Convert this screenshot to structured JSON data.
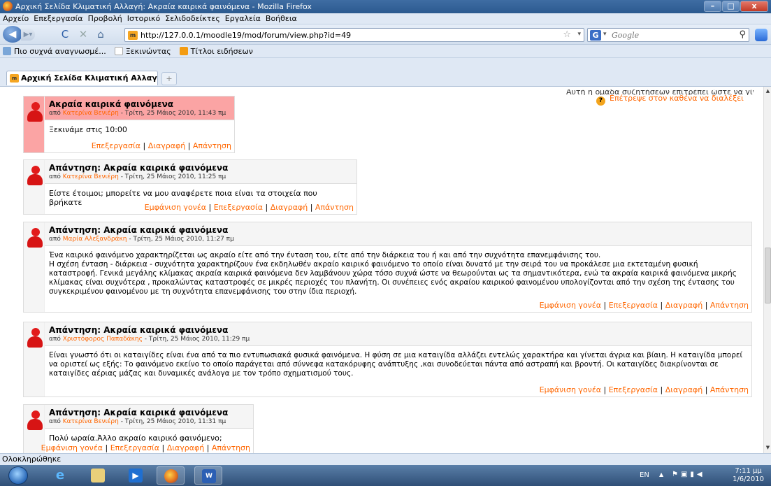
{
  "window": {
    "title": "Αρχική Σελίδα Κλιματική Αλλαγή: Ακραία καιρικά φαινόμενα - Mozilla Firefox",
    "min": "–",
    "max": "□",
    "close": "x"
  },
  "menu": [
    "Αρχείο",
    "Επεξεργασία",
    "Προβολή",
    "Ιστορικό",
    "Σελιδοδείκτες",
    "Εργαλεία",
    "Βοήθεια"
  ],
  "nav": {
    "url": "http://127.0.0.1/moodle19/mod/forum/view.php?id=49",
    "search_placeholder": "Google"
  },
  "bookmarks": [
    "Πιο συχνά αναγνωσμέ...",
    "Ξεκινώντας",
    "Τίτλοι ειδήσεων"
  ],
  "tab": {
    "label": "Αρχική Σελίδα Κλιματική Αλλαγή: Α...",
    "close": "×",
    "new": "+"
  },
  "forum": {
    "top_text_clipped": "Αυτή η ομάδα συζητήσεων επιτρέπει ώστε να γίνουν συνδρομητές",
    "subscribe_option": "Επέτρεψε στον καθένα να διαλέξει",
    "posts": [
      {
        "subject": "Ακραία καιρικά φαινόμενα",
        "by": "από",
        "author": "Κατερίνα Βενιέρη",
        "date": " - Τρίτη, 25 Μάιος 2010, 11:43 πμ",
        "body": "Ξεκινάμε στις 10:00",
        "cmds": [
          "Επεξεργασία",
          "Διαγραφή",
          "Απάντηση"
        ]
      },
      {
        "subject": "Απάντηση: Ακραία καιρικά φαινόμενα",
        "by": "από",
        "author": "Κατερίνα Βενιέρη",
        "date": " - Τρίτη, 25 Μάιος 2010, 11:25 πμ",
        "body": "Είστε έτοιμοι; μπορείτε να μου αναφέρετε ποια είναι τα στοιχεία που βρήκατε",
        "cmds": [
          "Εμφάνιση γονέα",
          "Επεξεργασία",
          "Διαγραφή",
          "Απάντηση"
        ]
      },
      {
        "subject": "Απάντηση: Ακραία καιρικά φαινόμενα",
        "by": "από",
        "author": "Μαρία Αλεξανδράκη",
        "date": " - Τρίτη, 25 Μάιος 2010, 11:27 πμ",
        "body": "Ένα καιρικό φαινόμενο χαρακτηρίζεται ως ακραίο είτε από την ένταση του, είτε από την διάρκεια του ή και από την συχνότητα επανεμφάνισης του.\nΗ σχέση ένταση - διάρκεια - συχνότητα χαρακτηρίζουν ένα εκδηλωθέν ακραίο καιρικό φαινόμενο το οποίο είναι δυνατό με την σειρά του να προκάλεσε μια εκτεταμένη φυσική καταστροφή. Γενικά μεγάλης κλίμακας ακραία καιρικά φαινόμενα δεν λαμβάνουν χώρα τόσο συχνά ώστε να θεωρούνται ως τα σημαντικότερα, ενώ τα ακραία καιρικά φαινόμενα μικρής κλίμακας είναι συχνότερα , προκαλώντας καταστροφές σε μικρές περιοχές του πλανήτη. Οι συνέπειες ενός ακραίου καιρικού φαινομένου υπολογίζονται από την σχέση της έντασης του συγκεκριμένου φαινομένου με τη συχνότητα επανεμφάνισης του στην ίδια περιοχή.",
        "cmds": [
          "Εμφάνιση γονέα",
          "Επεξεργασία",
          "Διαγραφή",
          "Απάντηση"
        ]
      },
      {
        "subject": "Απάντηση: Ακραία καιρικά φαινόμενα",
        "by": "από",
        "author": "Χριστόφορος Παπαδάκης",
        "date": " - Τρίτη, 25 Μάιος 2010, 11:29 πμ",
        "body": "Είναι γνωστό ότι οι καταιγίδες είναι ένα από τα πιο εντυπωσιακά φυσικά φαινόμενα. Η φύση σε μια καταιγίδα αλλάζει εντελώς χαρακτήρα και γίνεται άγρια και βίαιη. Η καταιγίδα μπορεί να οριστεί ως εξής: Το φαινόμενο εκείνο το οποίο παράγεται από σύννεφα κατακόρυφης ανάπτυξης ,και συνοδεύεται πάντα από αστραπή και βροντή. Οι καταιγίδες διακρίνονται σε καταιγίδες αέριας μάζας και δυναμικές ανάλογα με τον τρόπο σχηματισμού τους.",
        "cmds": [
          "Εμφάνιση γονέα",
          "Επεξεργασία",
          "Διαγραφή",
          "Απάντηση"
        ]
      },
      {
        "subject": "Απάντηση: Ακραία καιρικά φαινόμενα",
        "by": "από",
        "author": "Κατερίνα Βενιέρη",
        "date": " - Τρίτη, 25 Μάιος 2010, 11:31 πμ",
        "body": "Πολύ ωραία.Άλλο ακραίο καιρικό φαινόμενο;",
        "cmds": [
          "Εμφάνιση γονέα",
          "Επεξεργασία",
          "Διαγραφή",
          "Απάντηση"
        ]
      }
    ]
  },
  "status": "Ολοκληρώθηκε",
  "taskbar": {
    "lang": "EN",
    "time": "7:11 μμ",
    "date": "1/6/2010"
  }
}
